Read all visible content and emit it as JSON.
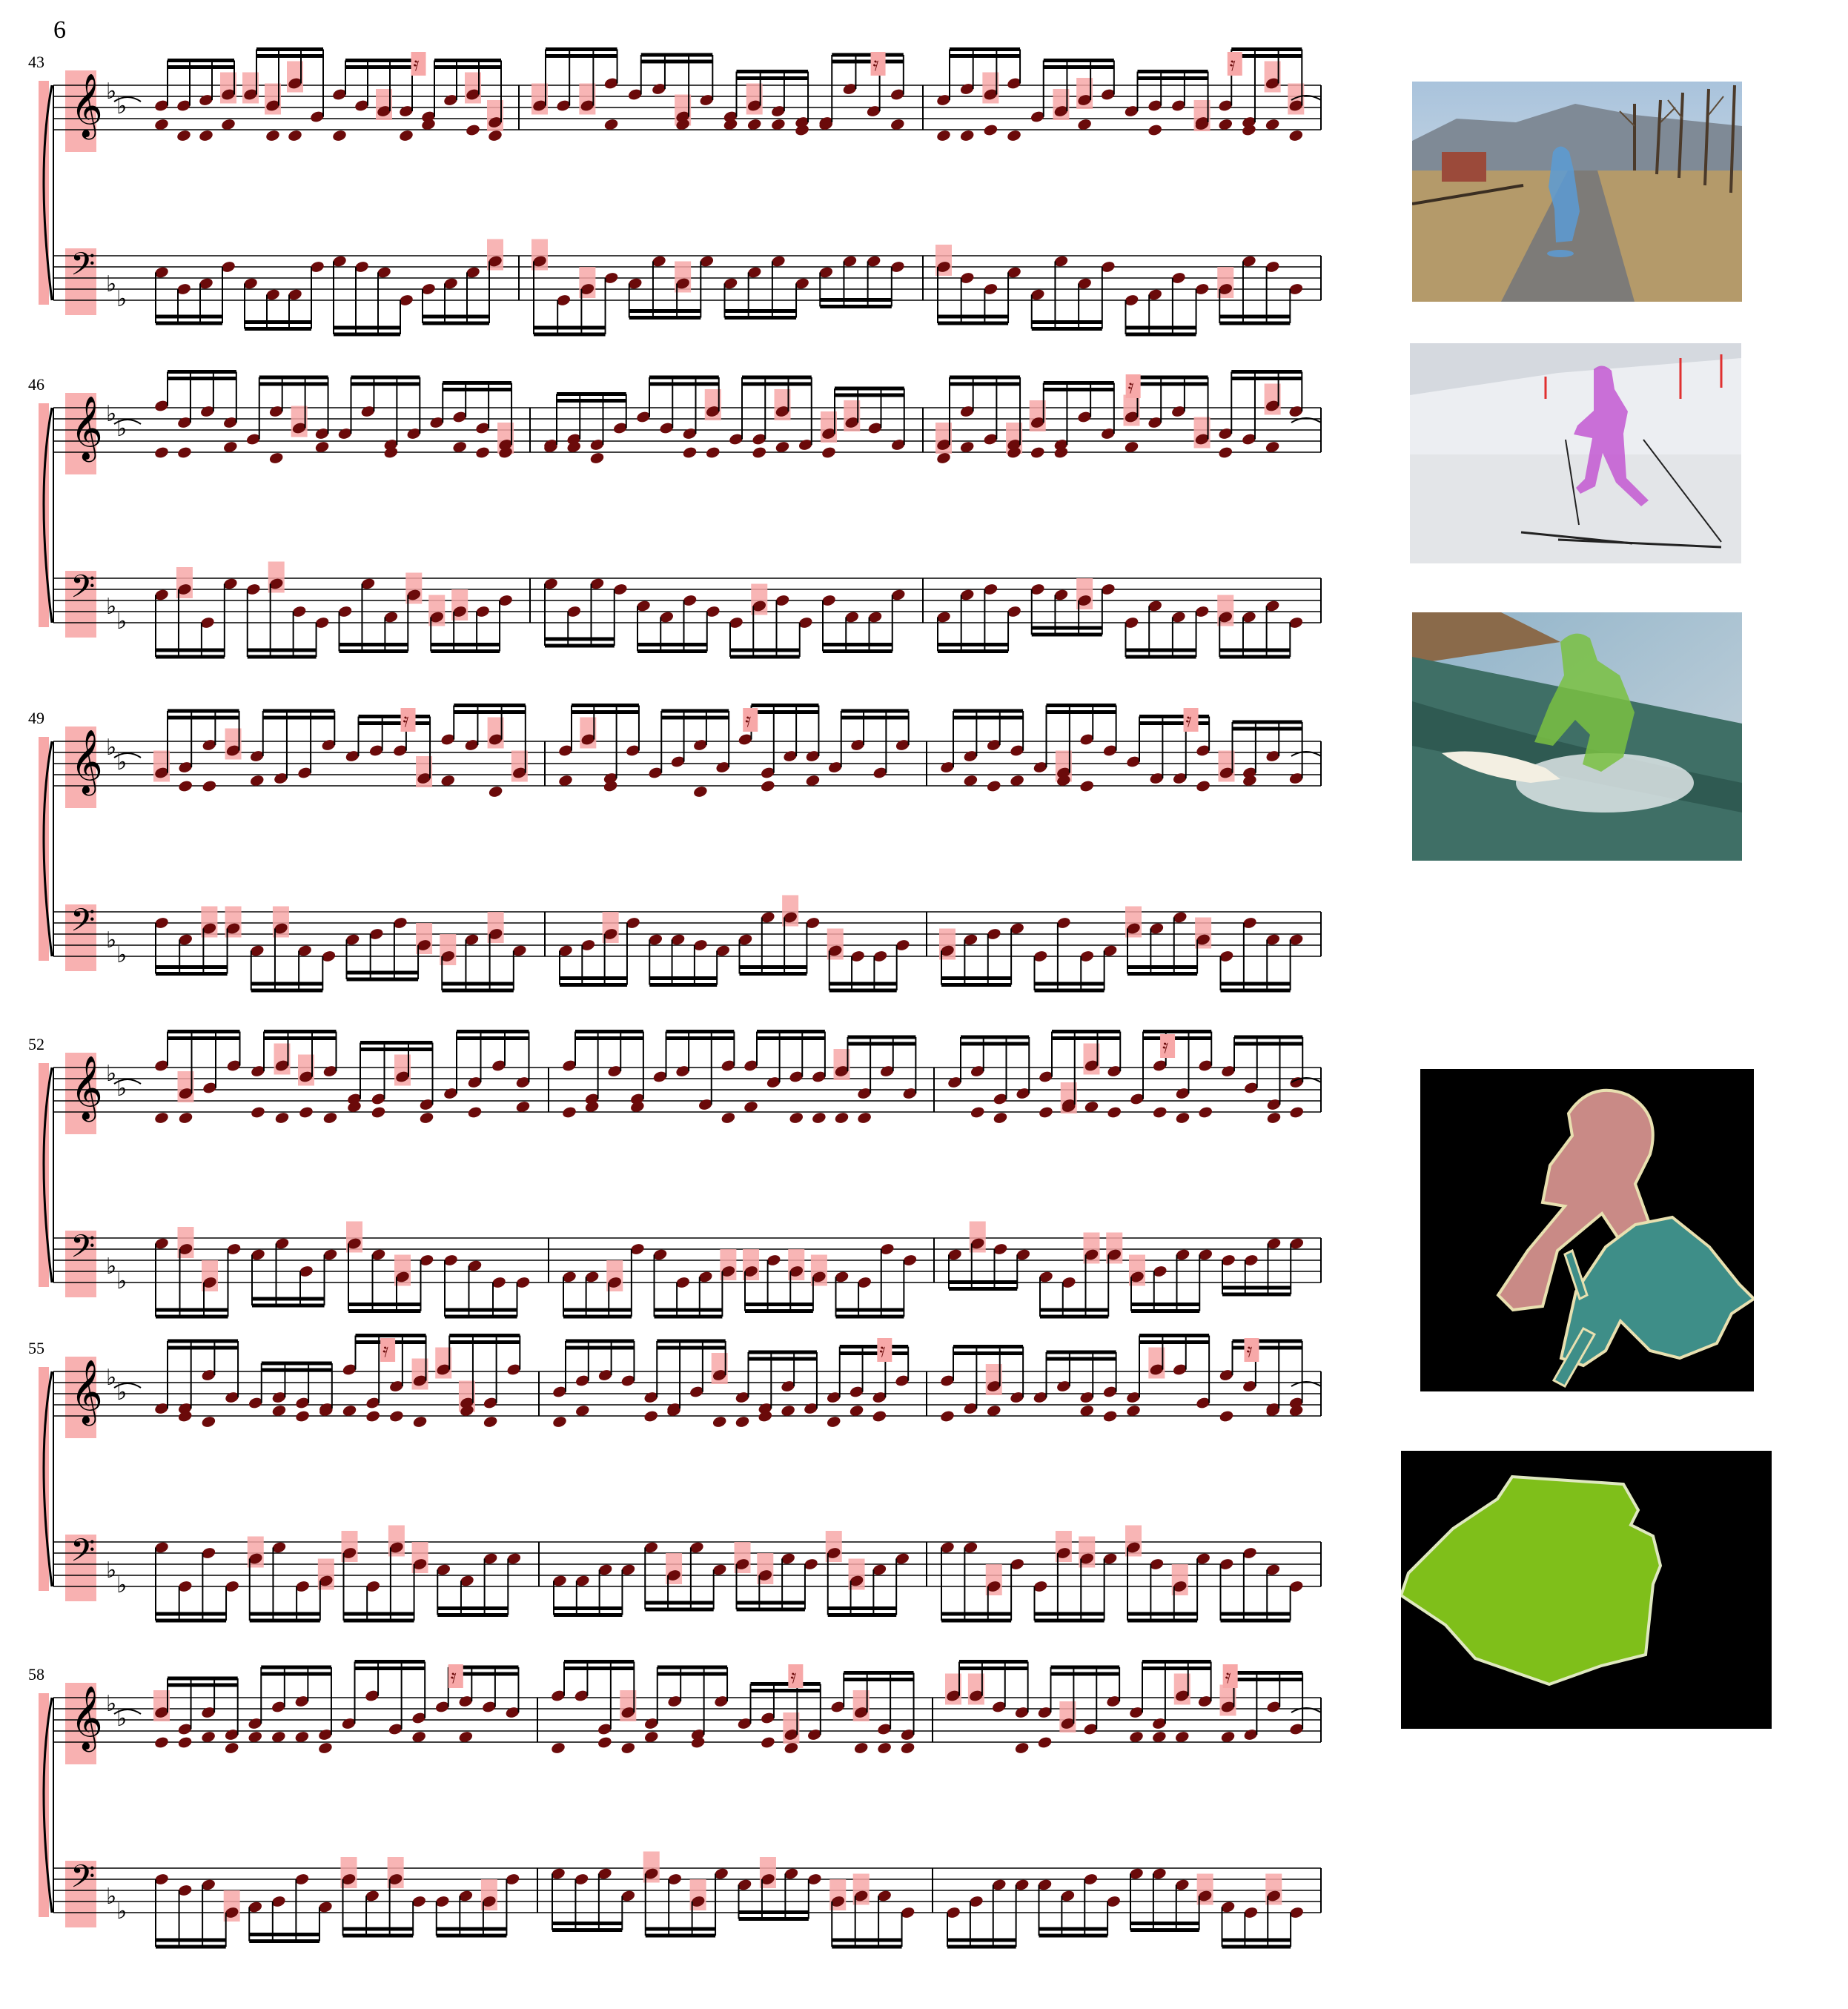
{
  "page": {
    "number": "6"
  },
  "score": {
    "systems": [
      {
        "measure_number": "43"
      },
      {
        "measure_number": "46"
      },
      {
        "measure_number": "49"
      },
      {
        "measure_number": "52"
      },
      {
        "measure_number": "55"
      },
      {
        "measure_number": "58"
      }
    ]
  },
  "thumbnails": [
    {
      "subject": "person on skateboard on road",
      "mask_color": "#5b9bd5"
    },
    {
      "subject": "skier in pink on snow",
      "mask_color": "#c04fd0"
    },
    {
      "subject": "surfer on wave",
      "mask_color": "#7ac142"
    },
    {
      "subject": "segmentation mask person and bicycle",
      "mask_colors": [
        "#c98a86",
        "#3e8e88"
      ]
    },
    {
      "subject": "segmentation mask single object",
      "mask_color": "#7fbf1a"
    }
  ],
  "colors": {
    "highlight": "#f7a8a8",
    "notehead": "#6b0a0a",
    "ink": "#000000"
  }
}
